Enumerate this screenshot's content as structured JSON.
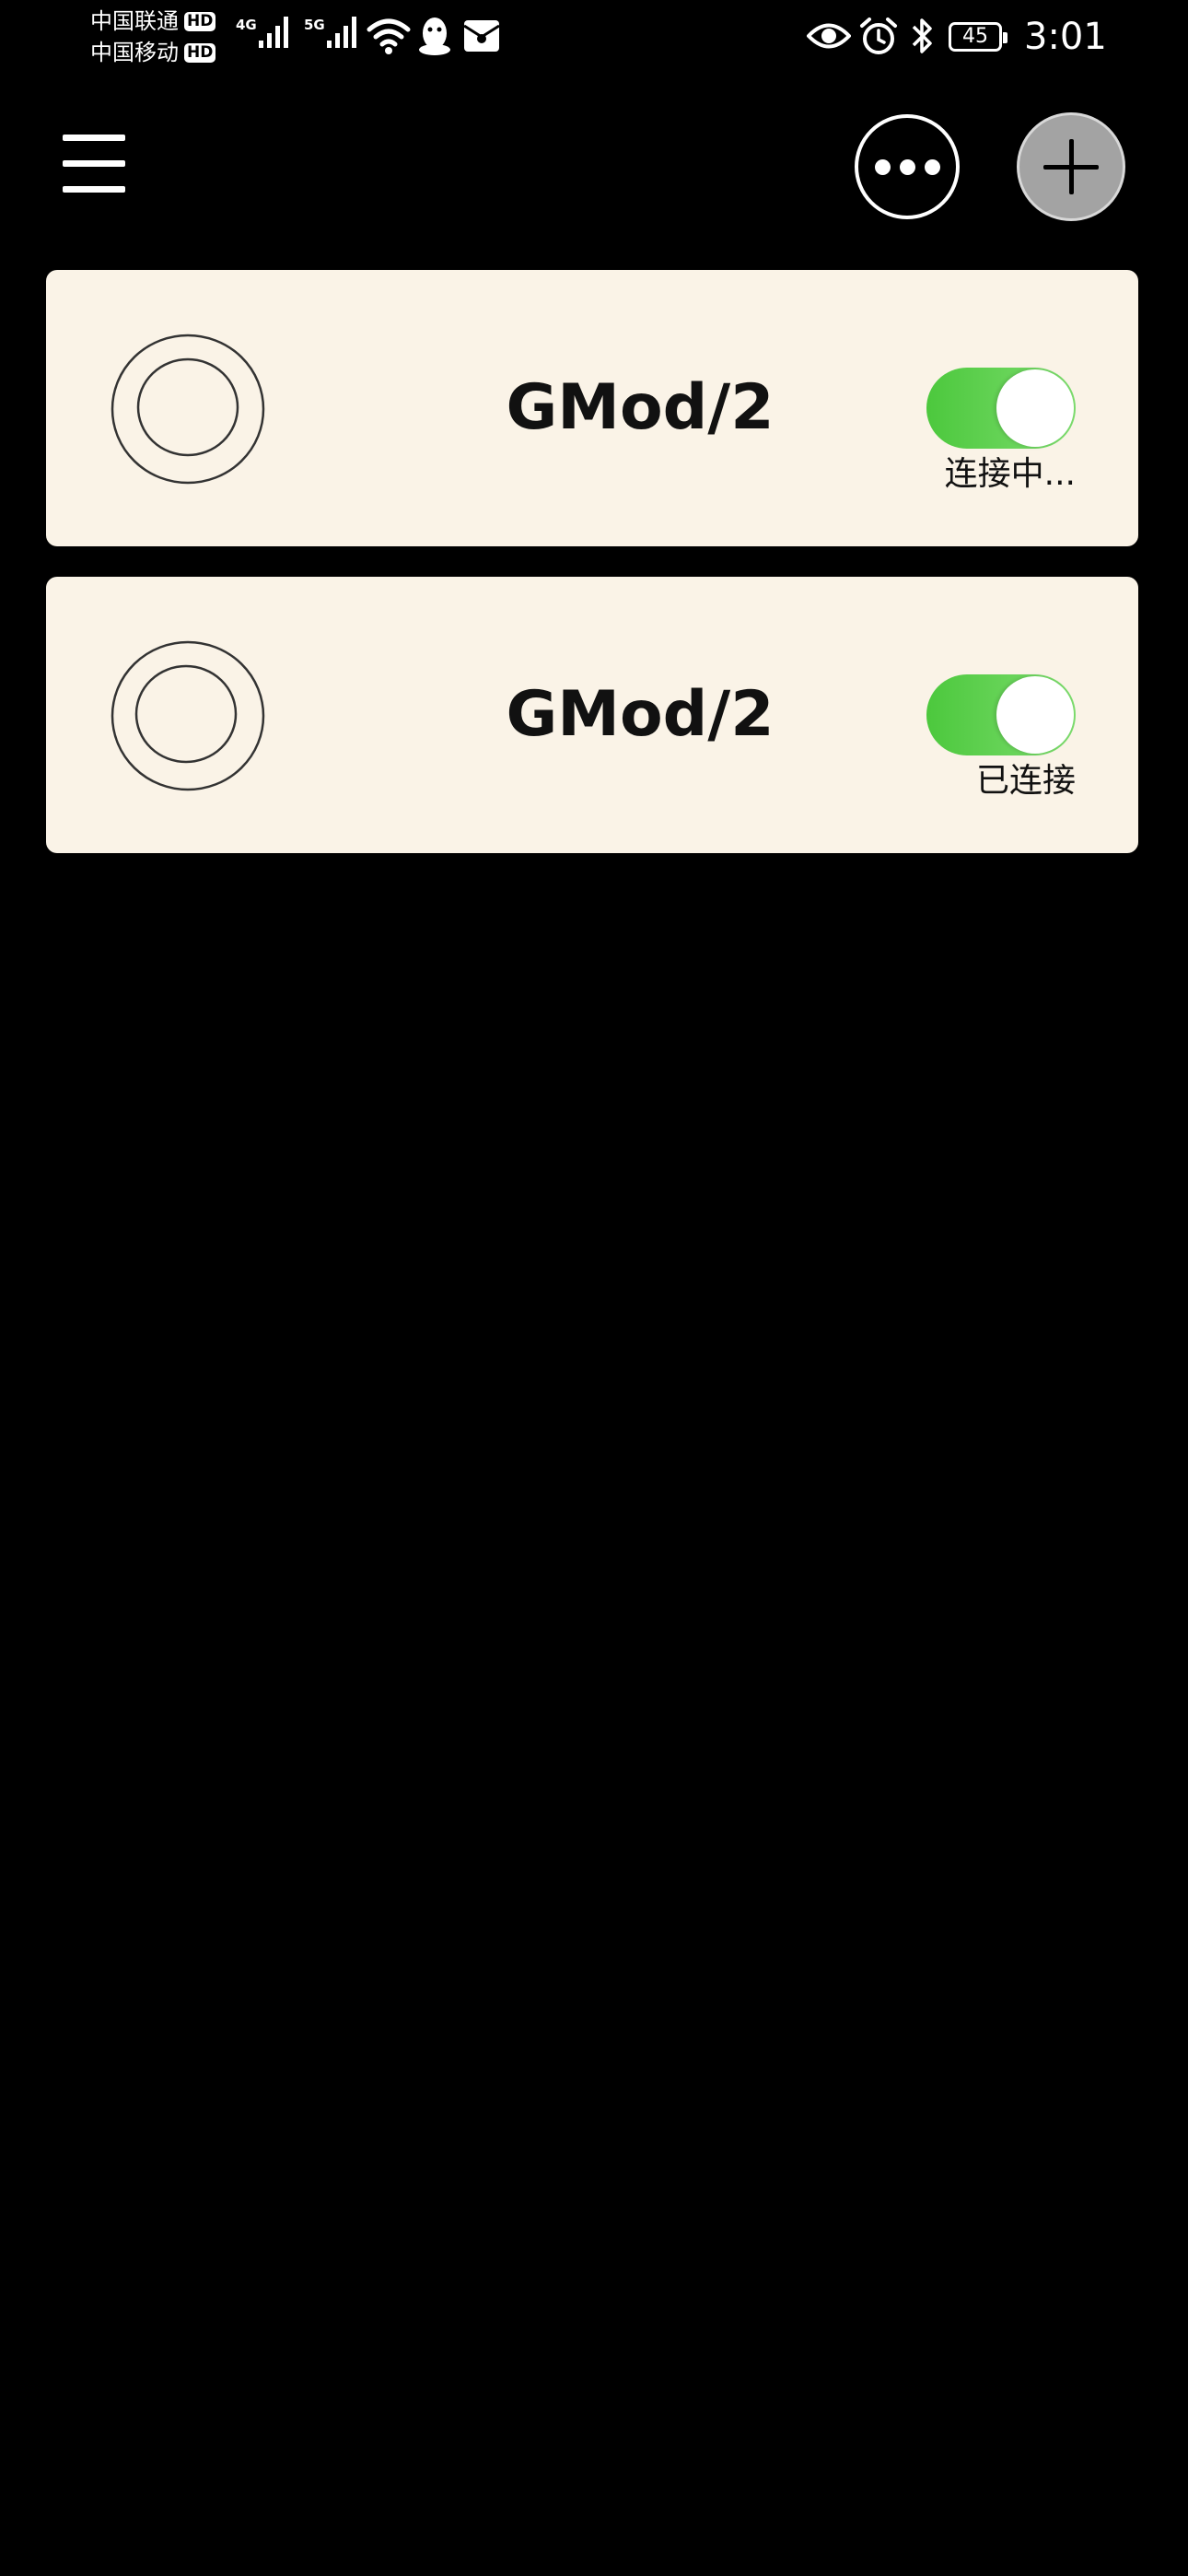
{
  "status_bar": {
    "carriers": [
      {
        "name": "中国联通",
        "badge": "HD"
      },
      {
        "name": "中国移动",
        "badge": "HD"
      }
    ],
    "signals": [
      {
        "network": "4G",
        "level": 4
      },
      {
        "network": "5G",
        "level": 4
      }
    ],
    "icons": [
      "wifi-icon",
      "qq-icon",
      "envelope-icon",
      "eye-icon",
      "alarm-icon",
      "bluetooth-icon"
    ],
    "battery_level": "45",
    "time": "3:01"
  },
  "top_bar": {
    "menu_icon": "hamburger-menu-icon",
    "more_icon": "more-dots-icon",
    "add_icon": "plus-icon"
  },
  "devices": [
    {
      "name": "GMod/2",
      "status": "连接中...",
      "enabled": true
    },
    {
      "name": "GMod/2",
      "status": "已连接",
      "enabled": true
    }
  ],
  "colors": {
    "background": "#000000",
    "card": "#faf3e7",
    "toggle_on": "#4cc83d",
    "add_button": "#a3a3a3"
  }
}
